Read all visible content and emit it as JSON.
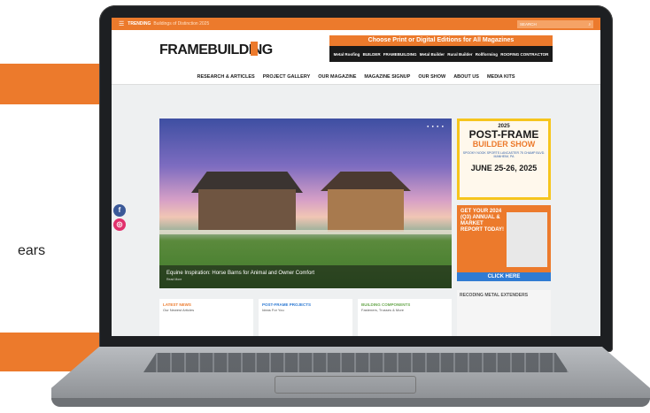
{
  "page": {
    "side_text": "ears"
  },
  "site": {
    "topbar": {
      "menu_icon": "menu-icon",
      "trending_label": "TRENDING",
      "trending_text": "Buildings of Distinction 2025",
      "search_placeholder": "SEARCH",
      "search_icon": "search-icon"
    },
    "logo": "FRAMEBUILDING",
    "editions": {
      "title": "Choose Print or Digital Editions for All Magazines",
      "logos": [
        "Metal Roofing",
        "BUILDER",
        "FRAMEBUILDING",
        "Metal Builder",
        "Rural Builder",
        "Rollforming",
        "ROOFING CONTRACTOR"
      ]
    },
    "nav": [
      "RESEARCH & ARTICLES",
      "PROJECT GALLERY",
      "OUR MAGAZINE",
      "MAGAZINE SIGNUP",
      "OUR SHOW",
      "ABOUT US",
      "MEDIA KITS"
    ],
    "hero": {
      "caption": "Equine Inspiration: Horse Barns for Animal and Owner Comfort",
      "caption_sub": "Read More"
    },
    "show_ad": {
      "year": "2025",
      "title": "POST-FRAME",
      "subtitle": "BUILDER SHOW",
      "venue": "SPOOKY NOOK SPORTS LANCASTER 75 CHAMP BLVD. MANHEIM, PA",
      "dates": "JUNE 25-26, 2025"
    },
    "market_ad": {
      "text": "GET YOUR 2024 (Q3) ANNUAL & MARKET REPORT TODAY!",
      "cta": "CLICK HERE"
    },
    "recoding_ad": {
      "label": "RECODING METAL EXTENDERS"
    },
    "cards": [
      {
        "title": "LATEST NEWS",
        "subtitle": "Our Newest Articles"
      },
      {
        "title": "POST-FRAME PROJECTS",
        "subtitle": "Ideas For You"
      },
      {
        "title": "BUILDING COMPONENTS",
        "subtitle": "Fasteners, Trusses & More"
      }
    ],
    "social": {
      "facebook_icon": "facebook-icon",
      "instagram_icon": "instagram-icon"
    }
  },
  "colors": {
    "accent": "#ec7a2c",
    "link_blue": "#2f7bd3",
    "yellow": "#f6c51d"
  }
}
